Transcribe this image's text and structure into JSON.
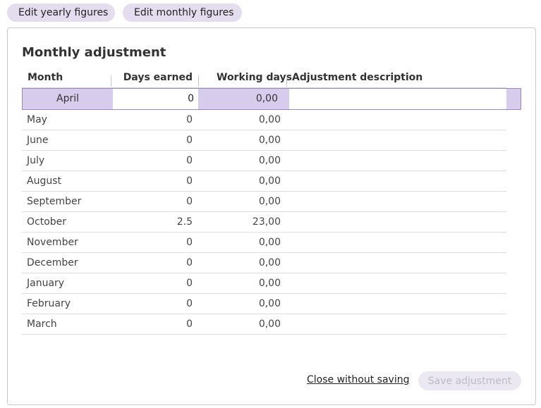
{
  "tabs": {
    "yearly_label": "Edit yearly figures",
    "monthly_label": "Edit monthly figures"
  },
  "panel": {
    "title": "Monthly adjustment",
    "columns": {
      "month": "Month",
      "days_earned": "Days earned",
      "working_days": "Working days",
      "description": "Adjustment description"
    },
    "rows": [
      {
        "month": "April",
        "days_earned": "0",
        "working_days": "0,00",
        "description": ""
      },
      {
        "month": "May",
        "days_earned": "0",
        "working_days": "0,00"
      },
      {
        "month": "June",
        "days_earned": "0",
        "working_days": "0,00"
      },
      {
        "month": "July",
        "days_earned": "0",
        "working_days": "0,00"
      },
      {
        "month": "August",
        "days_earned": "0",
        "working_days": "0,00"
      },
      {
        "month": "September",
        "days_earned": "0",
        "working_days": "0,00"
      },
      {
        "month": "October",
        "days_earned": "2.5",
        "working_days": "23,00"
      },
      {
        "month": "November",
        "days_earned": "0",
        "working_days": "0,00"
      },
      {
        "month": "December",
        "days_earned": "0",
        "working_days": "0,00"
      },
      {
        "month": "January",
        "days_earned": "0",
        "working_days": "0,00"
      },
      {
        "month": "February",
        "days_earned": "0",
        "working_days": "0,00"
      },
      {
        "month": "March",
        "days_earned": "0",
        "working_days": "0,00"
      }
    ],
    "close_label": "Close without saving",
    "save_label": "Save adjustment"
  },
  "colors": {
    "accent": "#e4dcef",
    "active_row": "#d7ccec",
    "active_border": "#9b89c6"
  }
}
